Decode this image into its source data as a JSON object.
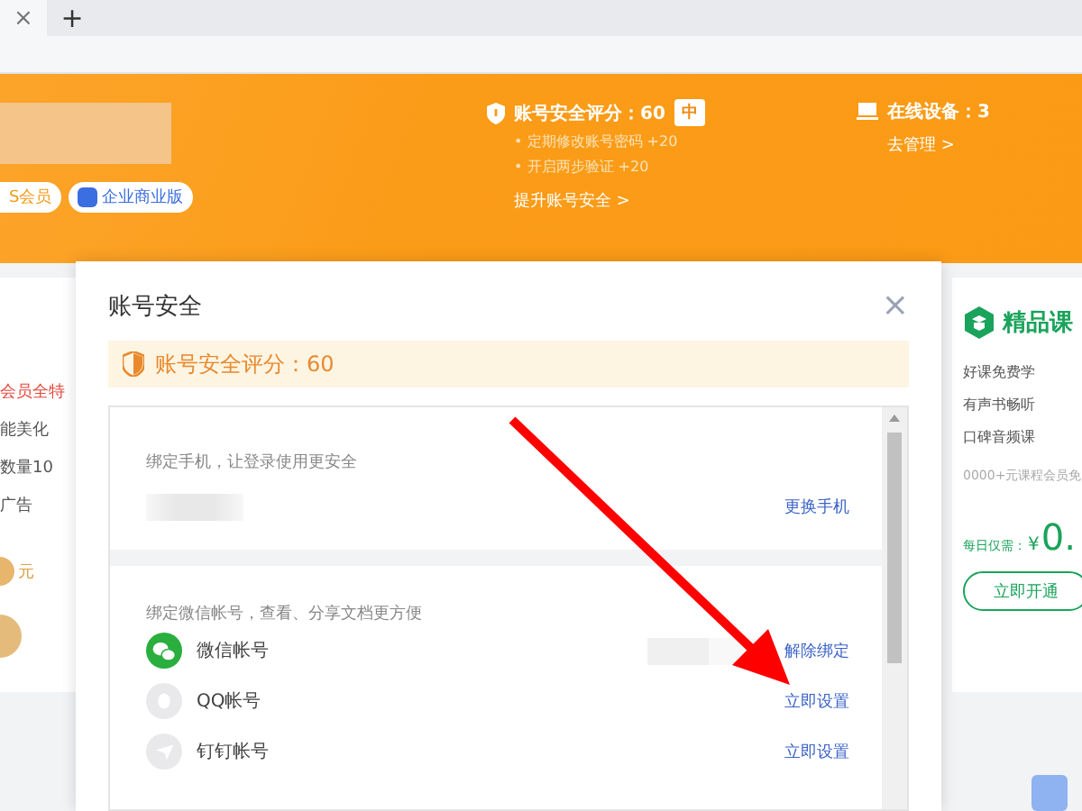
{
  "browser_tabs": {
    "close_label": "×",
    "new_tab_label": "+"
  },
  "profile": {
    "badges": [
      {
        "label": "S会员",
        "kind": "member"
      },
      {
        "label": "企业商业版",
        "kind": "enterprise"
      }
    ]
  },
  "security_summary": {
    "title": "账号安全评分：60",
    "level_badge": "中",
    "tips": [
      "• 定期修改账号密码 +20",
      "• 开启两步验证 +20"
    ],
    "link": "提升账号安全 >"
  },
  "devices": {
    "title": "在线设备：3",
    "link": "去管理 >"
  },
  "left_card": {
    "features": [
      {
        "label": "会员全特",
        "kind": "highlight"
      },
      {
        "label": "能美化",
        "kind": "plain"
      },
      {
        "label": "数量10",
        "kind": "plain"
      },
      {
        "label": "广告",
        "kind": "plain"
      }
    ],
    "price_unit": "元"
  },
  "right_card": {
    "title": "精品课",
    "features": [
      "好课免费学",
      "有声书畅听",
      "口碑音频课"
    ],
    "note": "0000+元课程会员免",
    "price_label": "每日仅需：",
    "currency": "¥",
    "price": "0.",
    "button": "立即开通"
  },
  "dialog": {
    "title": "账号安全",
    "close": "×",
    "score_notice": "账号安全评分：60",
    "sections": [
      {
        "description": "绑定手机，让登录使用更安全",
        "rows": [
          {
            "kind": "phone",
            "action": "更换手机"
          }
        ]
      },
      {
        "description": "绑定微信帐号，查看、分享文档更方便",
        "rows": [
          {
            "kind": "wechat",
            "label": "微信帐号",
            "bound": true,
            "action": "解除绑定"
          },
          {
            "kind": "qq",
            "label": "QQ帐号",
            "bound": false,
            "action": "立即设置"
          },
          {
            "kind": "dingtalk",
            "label": "钉钉帐号",
            "bound": false,
            "action": "立即设置"
          }
        ]
      }
    ]
  }
}
